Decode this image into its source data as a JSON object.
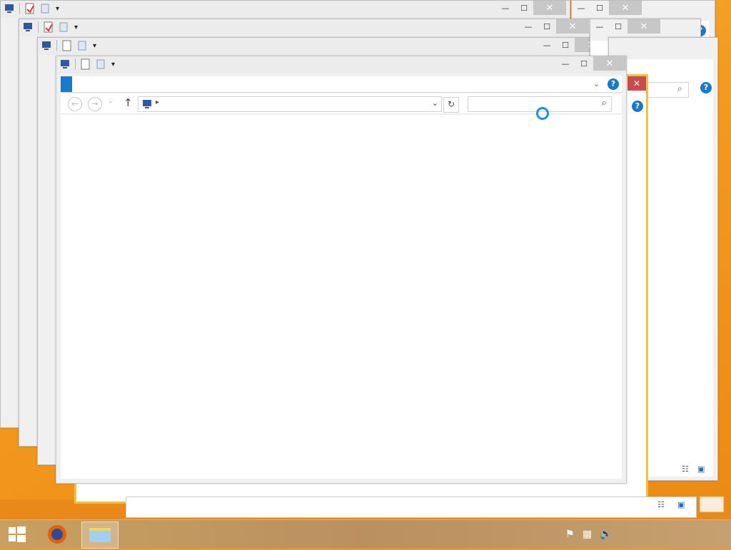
{
  "desktop": {
    "accent": "#f39a1f"
  },
  "window": {
    "title": "",
    "tabs": [
      {
        "label": ""
      },
      {
        "label": ""
      },
      {
        "label": ""
      },
      {
        "label": ""
      }
    ],
    "address_path": "",
    "search_placeholder": ""
  },
  "status_bar": {
    "item_count": ""
  },
  "taskbar": {
    "clock_time": "",
    "clock_date": ""
  },
  "colors": {
    "ribbon_file_tab": "#1979ca",
    "help_button": "#1979ca",
    "active_border": "#f0c040",
    "busy_cursor": "#1c8fe0"
  },
  "icons": [
    "computer-icon",
    "properties-icon",
    "new-folder-icon",
    "customize-dropdown-icon",
    "minimize-icon",
    "maximize-icon",
    "close-icon",
    "expand-ribbon-icon",
    "help-icon",
    "back-icon",
    "forward-icon",
    "recent-locations-icon",
    "up-icon",
    "breadcrumb-arrow-icon",
    "refresh-icon",
    "search-icon",
    "busy-cursor-icon",
    "details-view-icon",
    "large-icons-view-icon",
    "start-icon",
    "firefox-icon",
    "file-explorer-icon",
    "flag-icon",
    "network-icon",
    "volume-muted-icon"
  ]
}
